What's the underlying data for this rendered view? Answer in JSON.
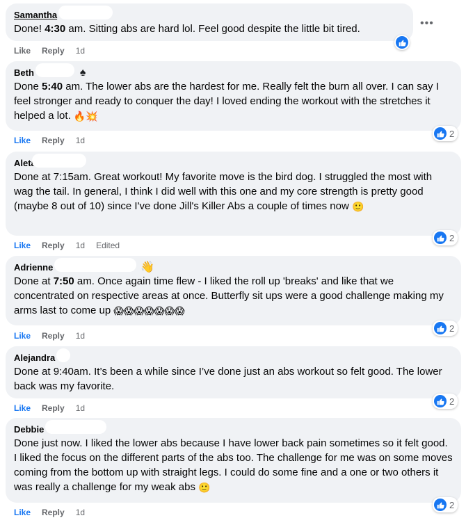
{
  "comments": [
    {
      "name": "Samantha",
      "parts": [
        {
          "t": "Done! "
        },
        {
          "b": "4:30"
        },
        {
          "t": " am. Sitting abs are hard lol. Feel good despite the little bit tired."
        }
      ],
      "like": "Like",
      "reply": "Reply",
      "time": "1d",
      "react_count": ""
    },
    {
      "name": "Beth",
      "flair_icon": "spade-icon",
      "parts": [
        {
          "t": "Done "
        },
        {
          "b": "5:40"
        },
        {
          "t": " am. The lower abs are the hardest for me. Really felt the burn all over. I can say I feel stronger and ready to conquer the day! I loved ending the workout with the stretches it helped a lot. "
        },
        {
          "e": "🔥💥"
        }
      ],
      "like": "Like",
      "reply": "Reply",
      "time": "1d",
      "react_count": "2"
    },
    {
      "name": "Aleta",
      "parts": [
        {
          "t": "Done at 7:15am. Great workout! My favorite move is the bird dog. I struggled the most with wag the tail. In general, I think I did well with this one and my core strength is pretty good (maybe 8 out of 10) since I've done Jill's Killer Abs a couple of times now "
        },
        {
          "e": "🙂"
        }
      ],
      "like": "Like",
      "reply": "Reply",
      "time": "1d",
      "edited": "Edited",
      "react_count": "2"
    },
    {
      "name": "Adrienne",
      "flair_icon": "waving-hand-icon",
      "parts": [
        {
          "t": "Done at "
        },
        {
          "b": "7:50"
        },
        {
          "t": " am. Once again time flew - I liked the roll up 'breaks' and like that we concentrated on respective areas at once. Butterfly sit ups were a good challenge making my arms last to come up "
        },
        {
          "e": "😱😱😱😱😱😱😱"
        }
      ],
      "like": "Like",
      "reply": "Reply",
      "time": "1d",
      "react_count": "2"
    },
    {
      "name": "Alejandra",
      "parts": [
        {
          "t": "Done at 9:40am. It’s been a while since I’ve done just an abs workout so felt good. The lower back was my favorite."
        }
      ],
      "like": "Like",
      "reply": "Reply",
      "time": "1d",
      "react_count": "2"
    },
    {
      "name": "Debbie",
      "parts": [
        {
          "t": "Done just now. I liked the lower abs because I have lower back pain sometimes so it felt good. I liked the focus on the different parts of the abs too. The challenge for me was on some moves coming from the bottom up with straight legs. I could do some fine and a one or two others it was really a challenge for my weak abs "
        },
        {
          "e": "🙂"
        }
      ],
      "like": "Like",
      "reply": "Reply",
      "time": "1d",
      "react_count": "2"
    }
  ],
  "icons": {
    "more": "more-options-icon",
    "reaction": "like-reaction-icon"
  },
  "colors": {
    "bubble": "#f0f2f5",
    "like_blue": "#1877f2",
    "meta_gray": "#65676b"
  }
}
